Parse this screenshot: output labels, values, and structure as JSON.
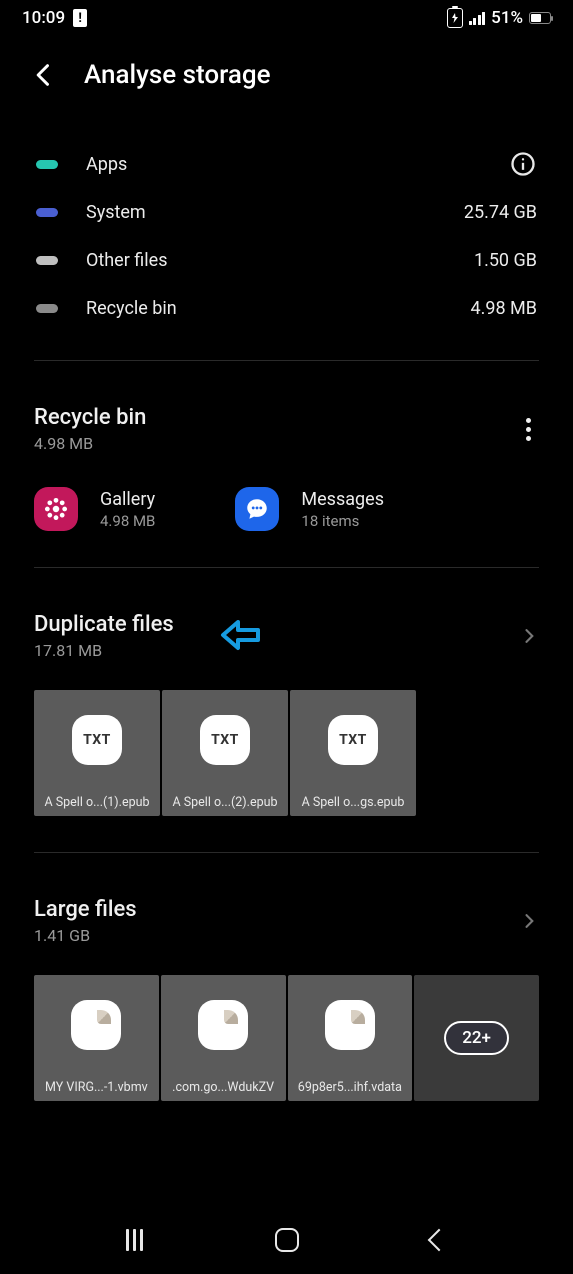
{
  "status": {
    "time": "10:09",
    "battery_pct": "51%"
  },
  "header": {
    "title": "Analyse storage"
  },
  "categories": [
    {
      "label": "Apps",
      "value": "",
      "color": "#26c6b0",
      "info": true
    },
    {
      "label": "System",
      "value": "25.74 GB",
      "color": "#4a5fd1",
      "info": false
    },
    {
      "label": "Other files",
      "value": "1.50 GB",
      "color": "#bfbfbf",
      "info": false
    },
    {
      "label": "Recycle bin",
      "value": "4.98 MB",
      "color": "#8a8a8a",
      "info": false
    }
  ],
  "recycle": {
    "title": "Recycle bin",
    "size": "4.98 MB",
    "items": [
      {
        "name": "Gallery",
        "meta": "4.98 MB",
        "icon": "gallery"
      },
      {
        "name": "Messages",
        "meta": "18 items",
        "icon": "messages"
      }
    ]
  },
  "duplicate": {
    "title": "Duplicate files",
    "size": "17.81 MB",
    "files": [
      {
        "name": "A Spell o...(1).epub",
        "kind": "txt"
      },
      {
        "name": "A Spell o...(2).epub",
        "kind": "txt"
      },
      {
        "name": "A Spell o...gs.epub",
        "kind": "txt"
      }
    ]
  },
  "large": {
    "title": "Large files",
    "size": "1.41 GB",
    "files": [
      {
        "name": "MY VIRG...-1.vbmv",
        "kind": "doc"
      },
      {
        "name": ".com.go...WdukZV",
        "kind": "doc"
      },
      {
        "name": "69p8er5...ihf.vdata",
        "kind": "doc"
      }
    ],
    "more_badge": "22+"
  }
}
